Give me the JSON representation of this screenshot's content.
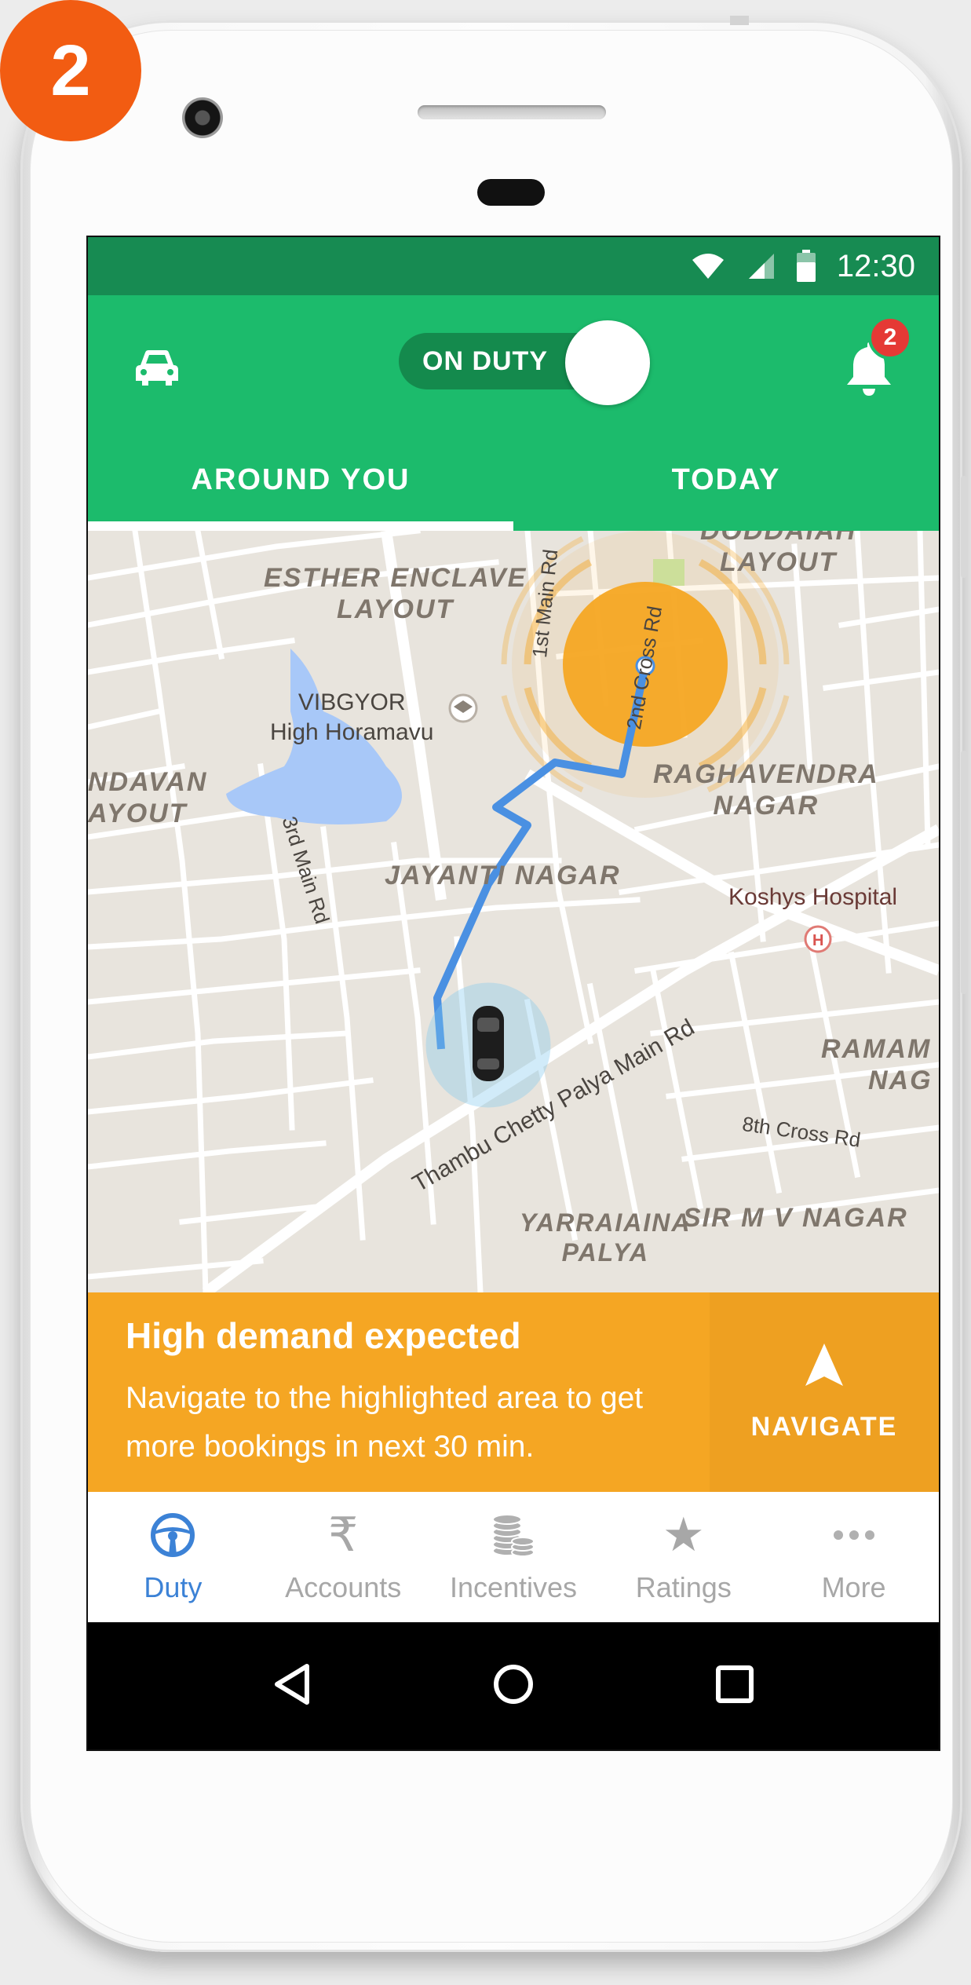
{
  "step": {
    "number": "2",
    "color": "#f25c12"
  },
  "status_bar": {
    "time": "12:30",
    "icons": [
      "wifi-icon",
      "signal-icon",
      "battery-icon"
    ]
  },
  "header": {
    "duty_toggle": {
      "label": "ON DUTY",
      "on": true
    },
    "notification_count": "2",
    "tabs": [
      {
        "label": "AROUND YOU",
        "active": true
      },
      {
        "label": "TODAY",
        "active": false
      }
    ],
    "color": "#1cbb6c"
  },
  "map": {
    "areas": [
      {
        "line1": "ESTHER ENCLAVE",
        "line2": "LAYOUT"
      },
      {
        "line1": "DODDAIAH",
        "line2": "LAYOUT"
      },
      {
        "line1": "NDAVAN",
        "line2": "AYOUT"
      },
      {
        "line1": "RAGHAVENDRA",
        "line2": "NAGAR"
      },
      {
        "line1": "JAYANTI NAGAR",
        "line2": ""
      },
      {
        "line1": "RAMAM",
        "line2": "NAG"
      },
      {
        "line1": "SIR M V NAGAR",
        "line2": ""
      },
      {
        "line1": "YARRAIAINA",
        "line2": "PALYA"
      }
    ],
    "places": [
      {
        "line1": "VIBGYOR",
        "line2": "High Horamavu"
      },
      {
        "line1": "Koshys Hospital",
        "line2": ""
      }
    ],
    "roads": [
      "1st Main Rd",
      "2nd Cross Rd",
      "3rd Main Rd",
      "Thambu Chetty Palya Main Rd",
      "8th Cross Rd"
    ],
    "route_color": "#4a90e2",
    "hotspot_color": "#f5a623"
  },
  "banner": {
    "title": "High demand expected",
    "body": "Navigate to the highlighted area to get more bookings in next 30 min.",
    "action": "NAVIGATE",
    "color": "#f5a623"
  },
  "bottom_nav": [
    {
      "label": "Duty",
      "icon": "steering-wheel-icon",
      "active": true
    },
    {
      "label": "Accounts",
      "icon": "rupee-icon",
      "active": false
    },
    {
      "label": "Incentives",
      "icon": "coins-icon",
      "active": false
    },
    {
      "label": "Ratings",
      "icon": "star-icon",
      "active": false
    },
    {
      "label": "More",
      "icon": "more-icon",
      "active": false
    }
  ],
  "system_nav": [
    "back-icon",
    "home-icon",
    "recents-icon"
  ]
}
